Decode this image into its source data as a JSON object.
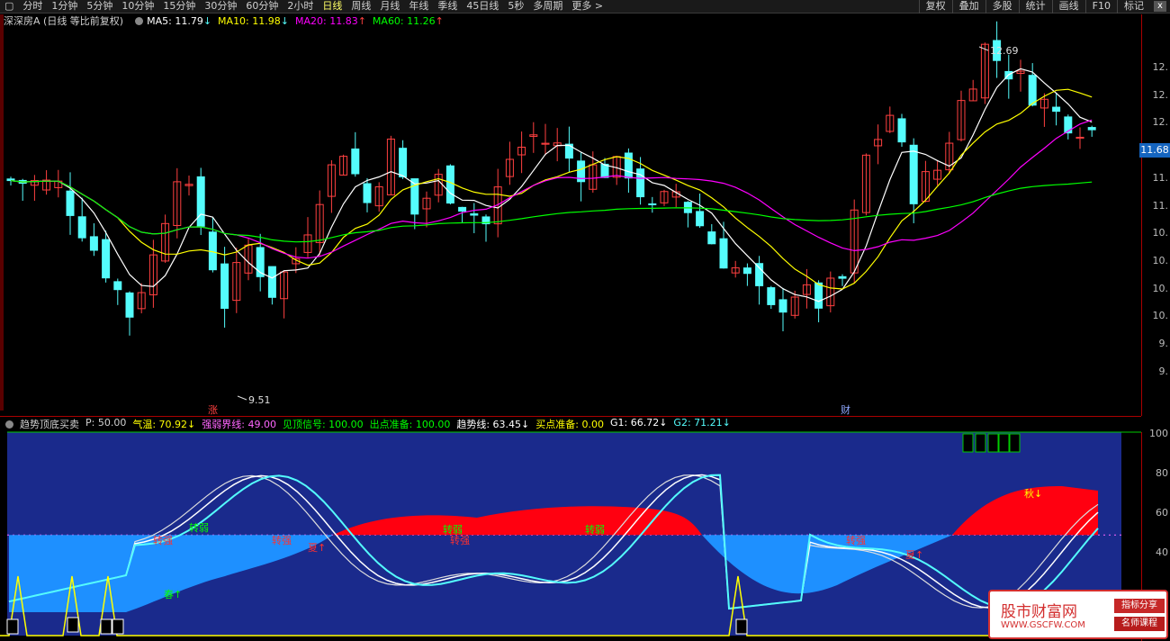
{
  "toolbar": {
    "periods": [
      "分时",
      "1分钟",
      "5分钟",
      "10分钟",
      "15分钟",
      "30分钟",
      "60分钟",
      "2小时",
      "日线",
      "周线",
      "月线",
      "年线",
      "季线",
      "45日线",
      "5秒",
      "多周期",
      "更多 >"
    ],
    "active": "日线",
    "right_buttons": [
      "复权",
      "叠加",
      "多股",
      "统计",
      "画线",
      "F10",
      "标记"
    ],
    "close_label": "x"
  },
  "main_chart": {
    "stock_title": "深深房A (日线 等比前复权)",
    "ma": [
      {
        "label": "MA5: 11.79",
        "arrow": "↓",
        "color": "#ffffff"
      },
      {
        "label": "MA10: 11.98",
        "arrow": "↓",
        "color": "#ffff00"
      },
      {
        "label": "MA20: 11.83",
        "arrow": "↑",
        "color": "#ff00ff"
      },
      {
        "label": "MA60: 11.26",
        "arrow": "↑",
        "color": "#00ff00"
      }
    ],
    "price_ticks": [
      "12.",
      "12.",
      "12.",
      "11.",
      "11.",
      "11.",
      "10.",
      "10.",
      "10.",
      "10.",
      "9.",
      "9."
    ],
    "current_price": "11.68",
    "high_label": "12.69",
    "low_label": "9.51",
    "markers": {
      "zhang": "涨",
      "cai": "财"
    },
    "colors": {
      "up": "#ff4040",
      "down": "#54fcfc",
      "ma5": "#ffffff",
      "ma10": "#ffff00",
      "ma20": "#ff00ff",
      "ma60": "#00ff00"
    }
  },
  "indicator": {
    "title": "趋势顶底买卖",
    "params": [
      {
        "label": "P: 50.00",
        "color": "#d0d0d0"
      },
      {
        "label": "气温: 70.92↓",
        "color": "#ffff00"
      },
      {
        "label": "强弱界线: 49.00",
        "color": "#ff66ff"
      },
      {
        "label": "见顶信号: 100.00",
        "color": "#00ff00"
      },
      {
        "label": "出点准备: 100.00",
        "color": "#00ff00"
      },
      {
        "label": "趋势线: 63.45↓",
        "color": "#ffffff"
      },
      {
        "label": "买点准备: 0.00",
        "color": "#ffff00"
      },
      {
        "label": "G1: 66.72↓",
        "color": "#ffffff"
      },
      {
        "label": "G2: 71.21↓",
        "color": "#54fcfc"
      }
    ],
    "axis_ticks": [
      "100",
      "80",
      "60",
      "40"
    ],
    "annotations": [
      {
        "text": "转弱",
        "color": "#00ff00"
      },
      {
        "text": "转强",
        "color": "#ff3030"
      },
      {
        "text": "春↑",
        "color": "#00ff00"
      },
      {
        "text": "转强",
        "color": "#ff3030"
      },
      {
        "text": "夏↑",
        "color": "#ff3030"
      },
      {
        "text": "转弱",
        "color": "#00ff00"
      },
      {
        "text": "转强",
        "color": "#ff3030"
      },
      {
        "text": "转弱",
        "color": "#00ff00"
      },
      {
        "text": "转强",
        "color": "#ff3030"
      },
      {
        "text": "夏↑",
        "color": "#ff3030"
      },
      {
        "text": "秋↓",
        "color": "#ffff00"
      }
    ]
  },
  "watermark": {
    "main": "股市财富网",
    "url": "WWW.GSCFW.COM",
    "tags": [
      "指标分享",
      "名师课程"
    ]
  }
}
